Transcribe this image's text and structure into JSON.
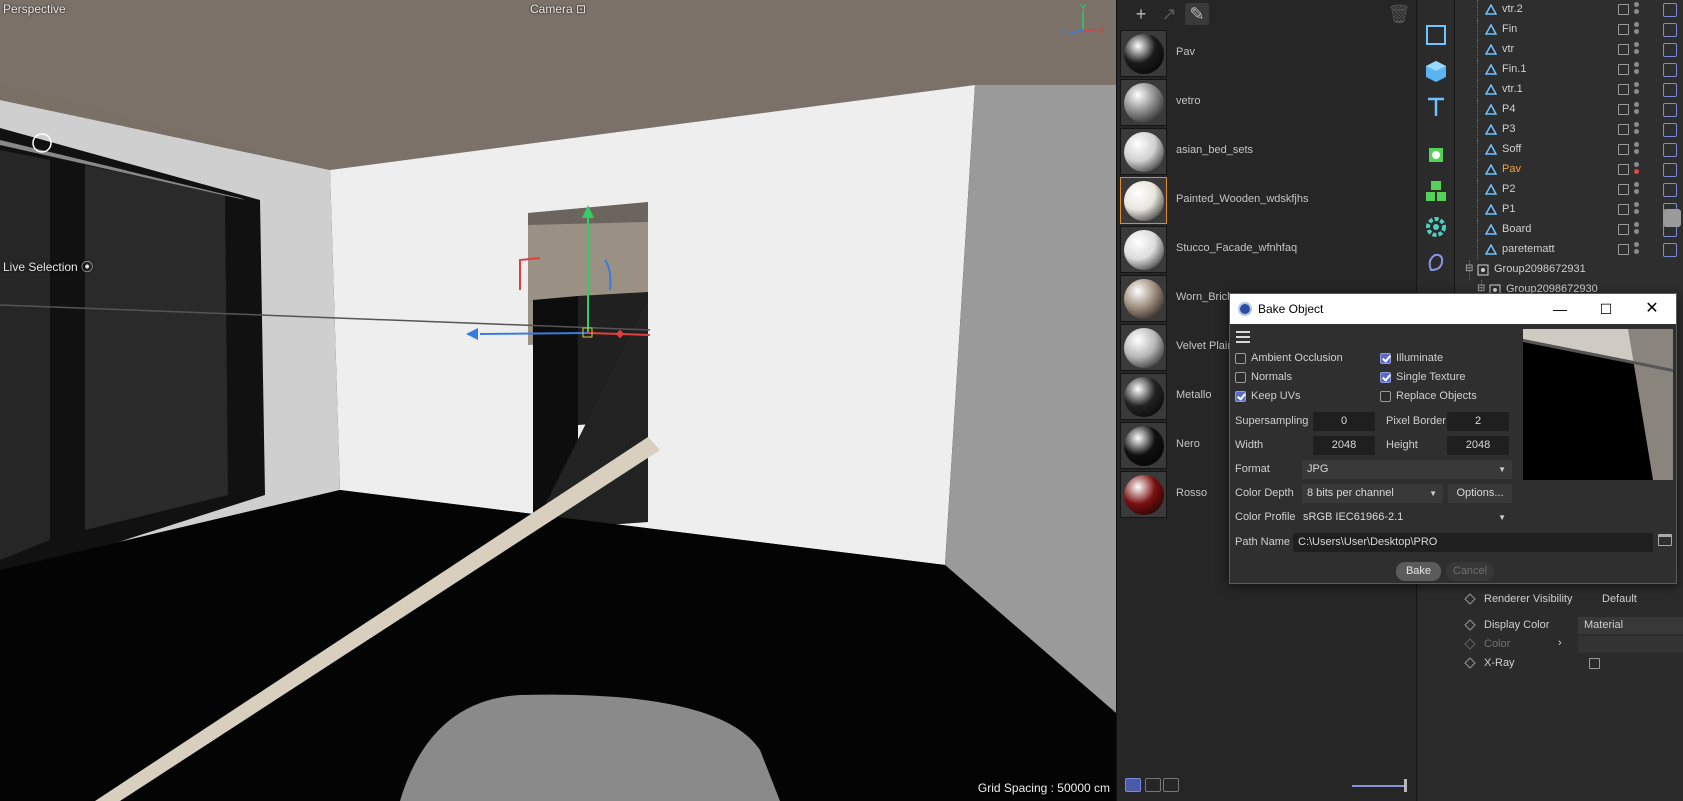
{
  "viewport": {
    "view_name": "Perspective",
    "camera_label": "Camera",
    "tool_label": "Live Selection",
    "grid_spacing": "Grid Spacing : 50000 cm",
    "axis": {
      "y": "Y",
      "x": "X",
      "z": "Z"
    }
  },
  "materials": {
    "items": [
      {
        "name": "Pav",
        "color": "#1a1a1a",
        "selected": false
      },
      {
        "name": "vetro",
        "color": "#8a8a8a",
        "selected": false
      },
      {
        "name": "asian_bed_sets",
        "color": "#d0d0d0",
        "selected": false
      },
      {
        "name": "Painted_Wooden_wdskfjhs",
        "color": "#e8e4dc",
        "selected": true
      },
      {
        "name": "Stucco_Facade_wfnhfaq",
        "color": "#dcdcdc",
        "selected": false
      },
      {
        "name": "Worn_Brick_",
        "color": "#9c8c7c",
        "selected": false
      },
      {
        "name": "Velvet Plain",
        "color": "#b8b8b8",
        "selected": false
      },
      {
        "name": "Metallo",
        "color": "#222222",
        "selected": false
      },
      {
        "name": "Nero",
        "color": "#101010",
        "selected": false
      },
      {
        "name": "Rosso",
        "color": "#7a1010",
        "selected": false
      }
    ]
  },
  "objects": {
    "items": [
      {
        "name": "vtr.2",
        "active": false
      },
      {
        "name": "Fin",
        "active": false
      },
      {
        "name": "vtr",
        "active": false
      },
      {
        "name": "Fin.1",
        "active": false
      },
      {
        "name": "vtr.1",
        "active": false
      },
      {
        "name": "P4",
        "active": false
      },
      {
        "name": "P3",
        "active": false
      },
      {
        "name": "Soff",
        "active": false
      },
      {
        "name": "Pav",
        "active": true
      },
      {
        "name": "P2",
        "active": false
      },
      {
        "name": "P1",
        "active": false
      },
      {
        "name": "Board",
        "active": false
      },
      {
        "name": "paretematt",
        "active": false
      },
      {
        "name": "Group2098672931",
        "active": false
      },
      {
        "name": "Group2098672930",
        "active": false
      }
    ]
  },
  "attributes": {
    "renderer_visibility": {
      "label": "Renderer Visibility",
      "value": "Default"
    },
    "display_color": {
      "label": "Display Color",
      "value": "Material"
    },
    "color": {
      "label": "Color"
    },
    "xray": {
      "label": "X-Ray"
    }
  },
  "bake": {
    "title": "Bake Object",
    "ambient_occlusion": {
      "label": "Ambient Occlusion",
      "checked": false
    },
    "normals": {
      "label": "Normals",
      "checked": false
    },
    "keep_uvs": {
      "label": "Keep UVs",
      "checked": true
    },
    "illuminate": {
      "label": "Illuminate",
      "checked": true
    },
    "single_texture": {
      "label": "Single Texture",
      "checked": true
    },
    "replace_objects": {
      "label": "Replace Objects",
      "checked": false
    },
    "supersampling": {
      "label": "Supersampling",
      "value": "0"
    },
    "pixel_border": {
      "label": "Pixel Border",
      "value": "2"
    },
    "width": {
      "label": "Width",
      "value": "2048"
    },
    "height": {
      "label": "Height",
      "value": "2048"
    },
    "format": {
      "label": "Format",
      "value": "JPG"
    },
    "color_depth": {
      "label": "Color Depth",
      "value": "8 bits per channel"
    },
    "options_label": "Options...",
    "color_profile": {
      "label": "Color Profile",
      "value": "sRGB IEC61966-2.1"
    },
    "path_name": {
      "label": "Path Name",
      "value": "C:\\Users\\User\\Desktop\\PRO"
    },
    "bake_label": "Bake",
    "cancel_label": "Cancel"
  },
  "colors": {
    "accent_blue": "#5a6cc8",
    "active_orange": "#f1a33b"
  }
}
